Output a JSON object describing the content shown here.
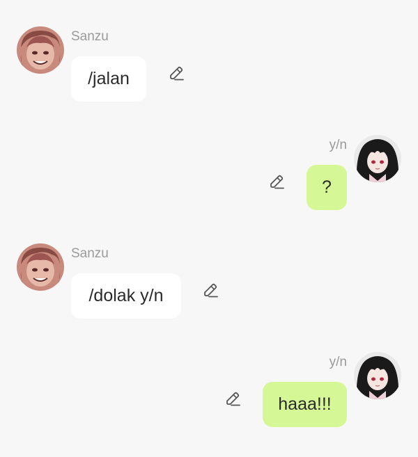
{
  "colors": {
    "background": "#f7f7f7",
    "incoming_bubble": "#ffffff",
    "outgoing_bubble": "#d6f795",
    "name_text": "#9a9a9a",
    "message_text": "#2a2a2a"
  },
  "messages": [
    {
      "sender": "Sanzu",
      "text": "/jalan",
      "side": "left",
      "avatar_icon": "sanzu-avatar",
      "edit_icon": "pencil-edit-icon"
    },
    {
      "sender": "y/n",
      "text": "?",
      "side": "right",
      "avatar_icon": "yn-avatar",
      "edit_icon": "pencil-edit-icon"
    },
    {
      "sender": "Sanzu",
      "text": "/dolak y/n",
      "side": "left",
      "avatar_icon": "sanzu-avatar",
      "edit_icon": "pencil-edit-icon"
    },
    {
      "sender": "y/n",
      "text": "haaa!!!",
      "side": "right",
      "avatar_icon": "yn-avatar",
      "edit_icon": "pencil-edit-icon"
    }
  ]
}
